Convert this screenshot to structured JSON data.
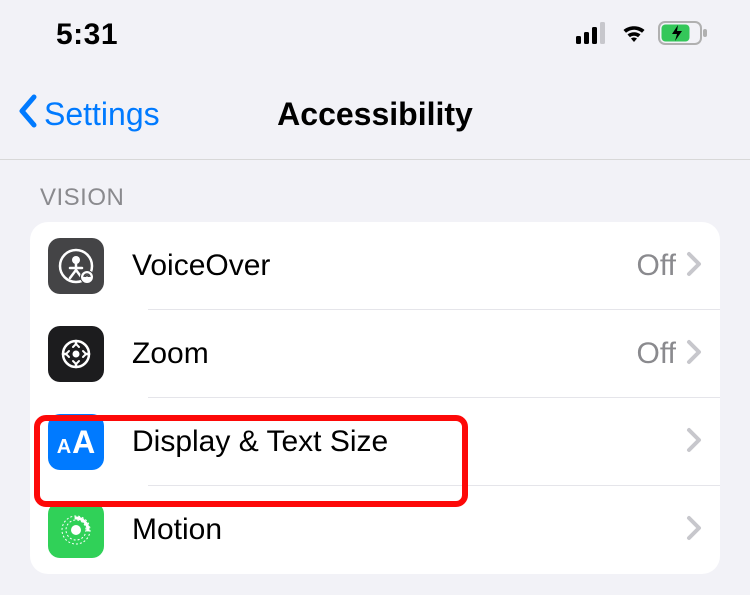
{
  "status": {
    "time": "5:31"
  },
  "nav": {
    "back_label": "Settings",
    "title": "Accessibility"
  },
  "section": {
    "header": "VISION"
  },
  "rows": {
    "voiceover": {
      "label": "VoiceOver",
      "status": "Off"
    },
    "zoom": {
      "label": "Zoom",
      "status": "Off"
    },
    "display": {
      "label": "Display & Text Size"
    },
    "motion": {
      "label": "Motion"
    }
  },
  "colors": {
    "accent": "#007aff",
    "row_icon_darkgray": "#444446",
    "row_icon_black": "#1c1c1e",
    "row_icon_blue": "#007aff",
    "row_icon_green": "#30d158",
    "battery_green": "#34c759",
    "highlight_red": "#fd0908"
  }
}
